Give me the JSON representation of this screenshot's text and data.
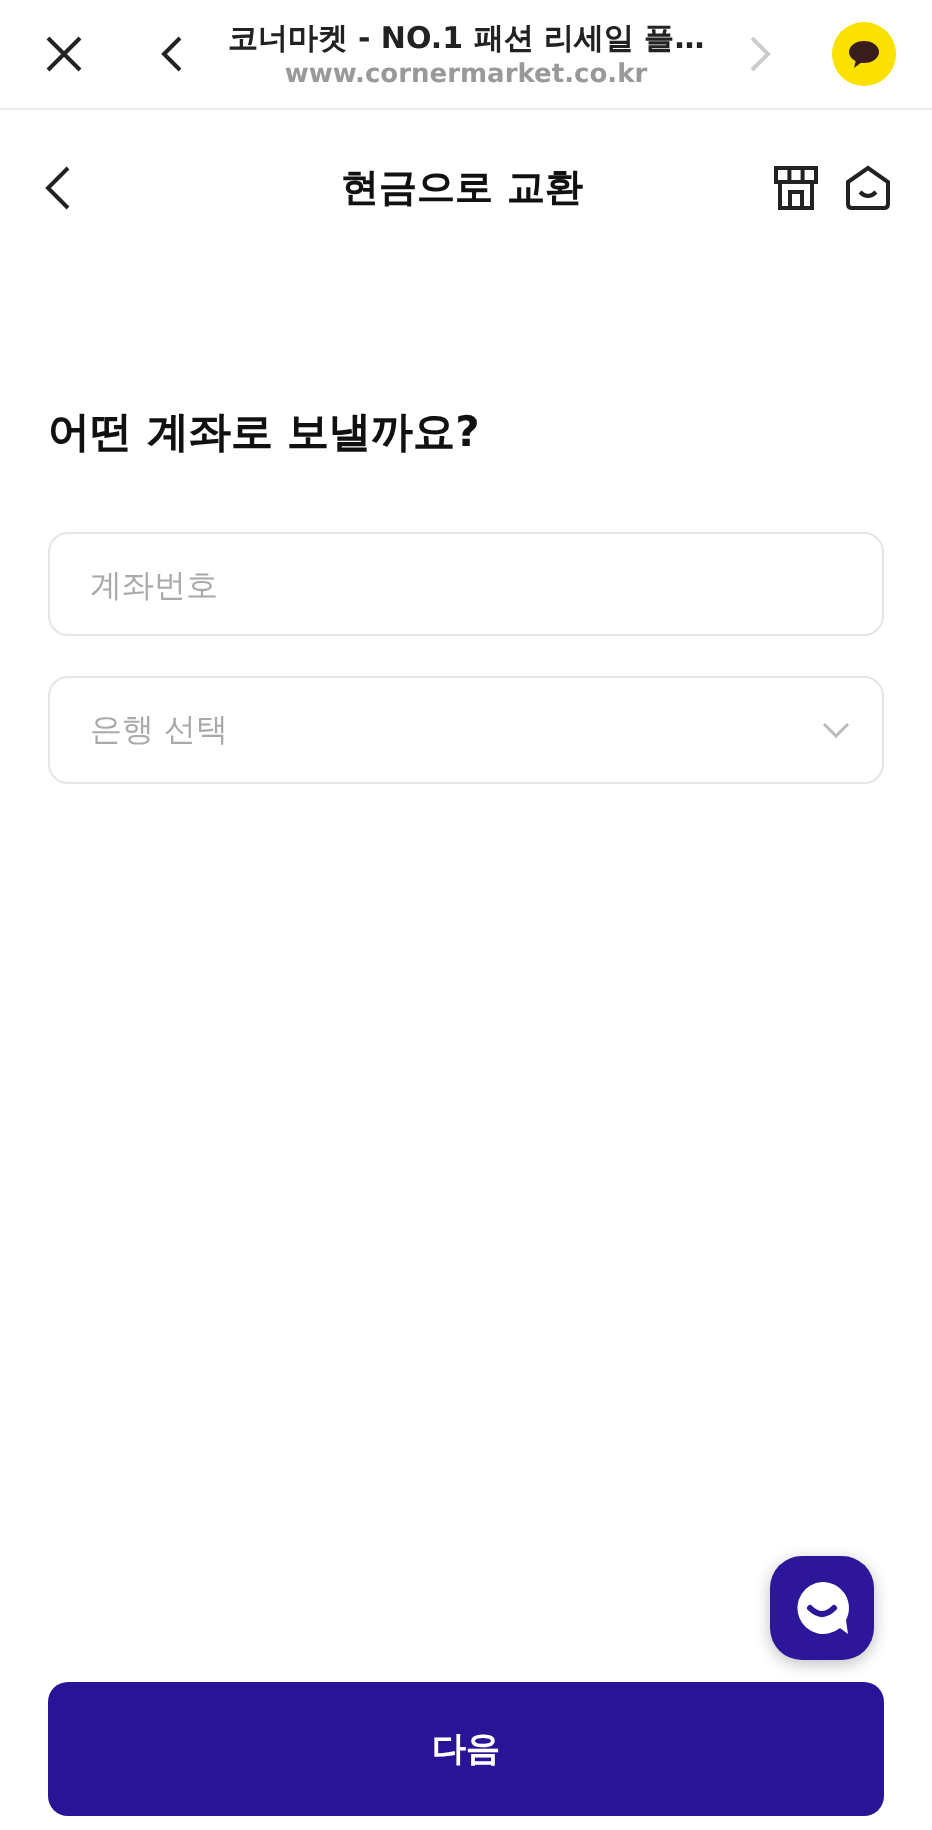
{
  "browser_bar": {
    "page_title": "코너마켓 - NO.1 패션 리세일 플…",
    "url": "www.cornermarket.co.kr",
    "forward": {
      "disabled": true
    }
  },
  "header": {
    "title": "현금으로 교환"
  },
  "heading": "어떤 계좌로 보낼까요?",
  "account_field": {
    "placeholder": "계좌번호"
  },
  "bank_select": {
    "placeholder": "은행 선택"
  },
  "next_button": "다음"
}
